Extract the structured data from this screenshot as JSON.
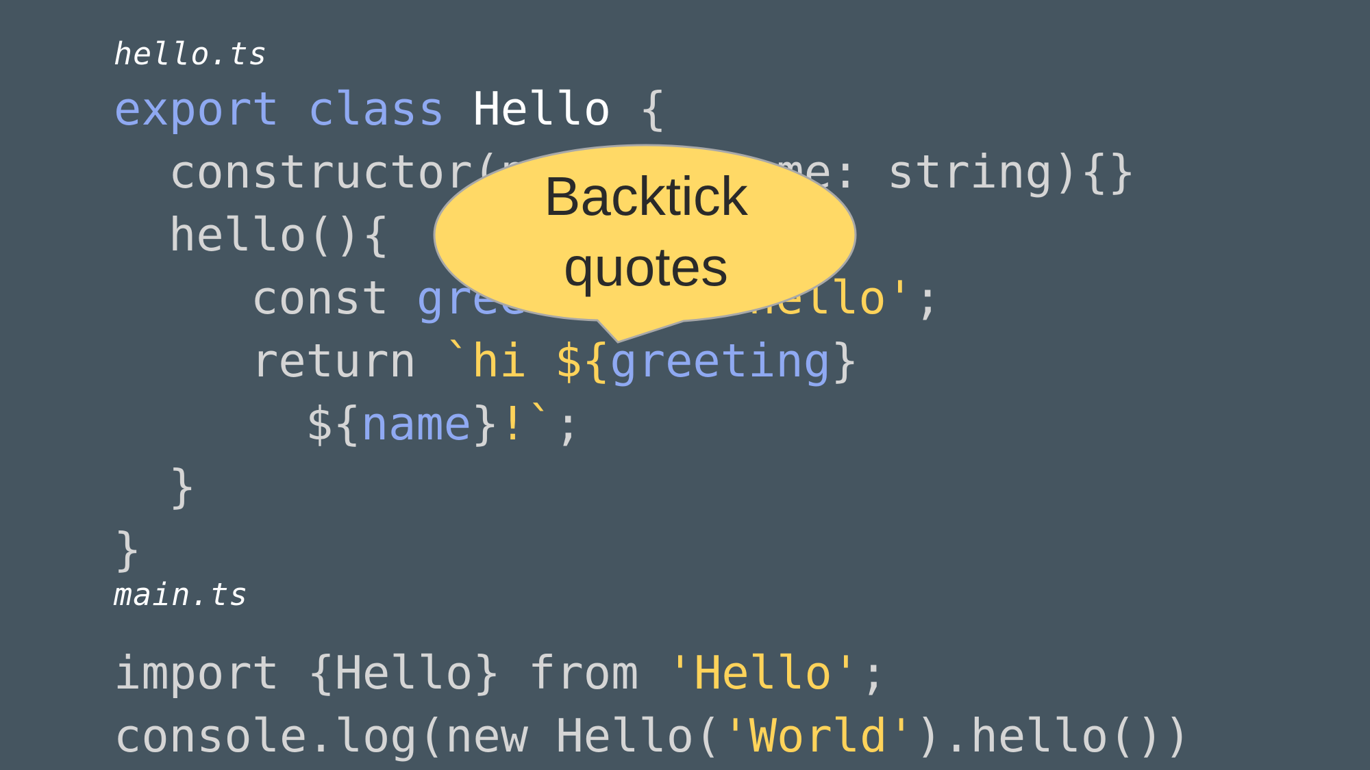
{
  "colors": {
    "background": "#455560",
    "plain": "#d5d5d5",
    "keyword": "#8fa9f2",
    "string": "#ffd35a",
    "callout_fill": "#ffd966",
    "callout_border": "#a8a8a8"
  },
  "files": {
    "hello": "hello.ts",
    "main": "main.ts"
  },
  "code": {
    "l1": {
      "kw1": "export",
      "kw2": "class",
      "name": "Hello",
      "brace": "{"
    },
    "l2": {
      "a": "constructor(",
      "b": "private name",
      "c": ": string){}"
    },
    "l3": {
      "a": "hello(){"
    },
    "l4": {
      "a": "const ",
      "var": "greeting",
      "eq": " = ",
      "str": "'hello'",
      "semi": ";"
    },
    "l5": {
      "a": "return ",
      "str1": "`hi ${",
      "var": "greeting",
      "close": "}"
    },
    "l6": {
      "a": "${",
      "var": "name",
      "b": "}",
      "str": "!`",
      "semi": ";"
    },
    "l7": {
      "a": "}"
    },
    "l8": {
      "a": "}"
    },
    "l9": {
      "a": "import {Hello} from ",
      "str": "'Hello'",
      "semi": ";"
    },
    "l10": {
      "a": "console.log(new Hello(",
      "str": "'World'",
      "b": ").hello())"
    }
  },
  "callout": {
    "line1": "Backtick",
    "line2": "quotes"
  }
}
